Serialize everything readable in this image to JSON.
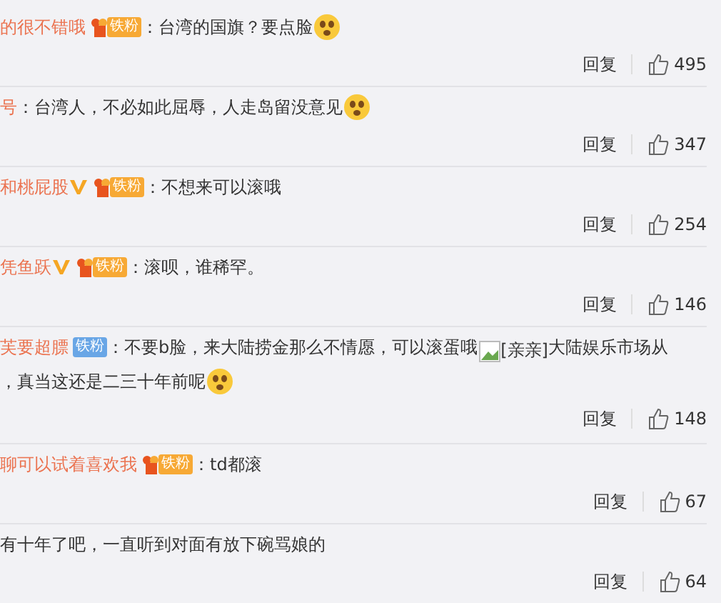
{
  "comments": [
    {
      "user": "的很不错哦",
      "verified": false,
      "badge": {
        "kind": "fan-gold",
        "label": "铁粉"
      },
      "lines": [
        [
          {
            "kind": "text",
            "text": "：台湾的国旗？要点脸"
          },
          {
            "kind": "emoji"
          }
        ]
      ],
      "reply": "回复",
      "likes": "495"
    },
    {
      "user": "号",
      "verified": false,
      "lines": [
        [
          {
            "kind": "text",
            "text": "：台湾人，不必如此屈辱，人走岛留没意见"
          },
          {
            "kind": "emoji"
          }
        ]
      ],
      "reply": "回复",
      "likes": "347"
    },
    {
      "user": "和桃屁股",
      "verified": true,
      "badge": {
        "kind": "fan-gold",
        "label": "铁粉"
      },
      "lines": [
        [
          {
            "kind": "text",
            "text": "：不想来可以滚哦"
          }
        ]
      ],
      "reply": "回复",
      "likes": "254"
    },
    {
      "user": "凭鱼跃",
      "verified": true,
      "badge": {
        "kind": "fan-gold",
        "label": "铁粉"
      },
      "lines": [
        [
          {
            "kind": "text",
            "text": "：滚呗，谁稀罕。"
          }
        ]
      ],
      "reply": "回复",
      "likes": "146"
    },
    {
      "user": "芙要超膘",
      "verified": false,
      "badge": {
        "kind": "fan-blue",
        "label": "铁粉"
      },
      "lines": [
        [
          {
            "kind": "text",
            "text": "：不要b脸，来大陆捞金那么不情愿，可以滚蛋哦"
          },
          {
            "kind": "image",
            "alt": "[亲亲]"
          },
          {
            "kind": "text",
            "text": "大陆娱乐市场从"
          }
        ],
        [
          {
            "kind": "text",
            "text": "，真当这还是二三十年前呢"
          },
          {
            "kind": "emoji"
          }
        ]
      ],
      "reply": "回复",
      "likes": "148"
    },
    {
      "user": "聊可以试着喜欢我",
      "verified": false,
      "badge": {
        "kind": "fan-gold",
        "label": "铁粉"
      },
      "lines": [
        [
          {
            "kind": "text",
            "text": "：td都滚"
          }
        ]
      ],
      "reply": "回复",
      "likes": "67"
    },
    {
      "lines": [
        [
          {
            "kind": "text",
            "text": "有十年了吧，一直听到对面有放下碗骂娘的"
          }
        ]
      ],
      "reply": "回复",
      "likes": "64"
    }
  ]
}
